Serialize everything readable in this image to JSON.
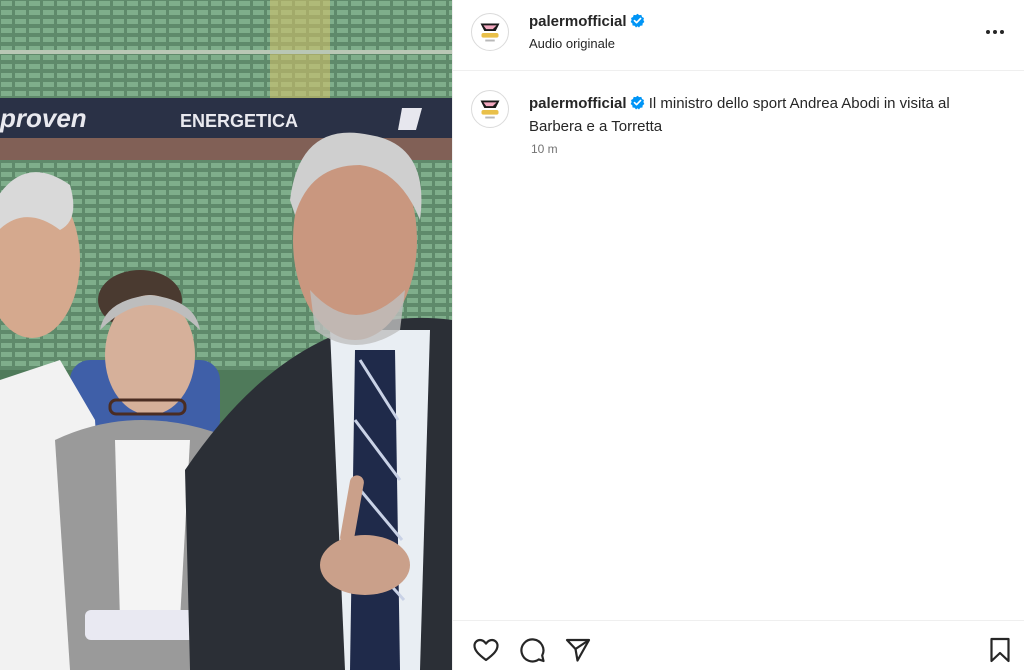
{
  "post": {
    "username": "palermofficial",
    "audio": "Audio originale",
    "caption": "Il ministro dello sport Andrea Abodi in visita al Barbera e a Torretta",
    "time": "10 m",
    "verified": true
  },
  "media": {
    "banner_left": "proven",
    "banner_center": "ENERGETICA"
  },
  "icons": {
    "more": "more-options-icon",
    "like": "heart-icon",
    "comment": "comment-icon",
    "share": "send-icon",
    "save": "bookmark-icon",
    "verified": "verified-badge-icon"
  },
  "colors": {
    "verified": "#0095f6",
    "text": "#262626",
    "muted": "#737373",
    "divider": "#efefef"
  }
}
